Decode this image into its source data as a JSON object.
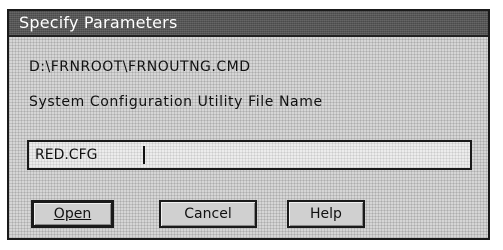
{
  "dialog": {
    "title": "Specify Parameters",
    "path": "D:\\FRNROOT\\FRNOUTNG.CMD",
    "field_label": "System Configuration Utility File Name",
    "field_value": "RED.CFG"
  },
  "buttons": {
    "open_label": "Open",
    "cancel_label": "Cancel",
    "help_label": "Help"
  }
}
